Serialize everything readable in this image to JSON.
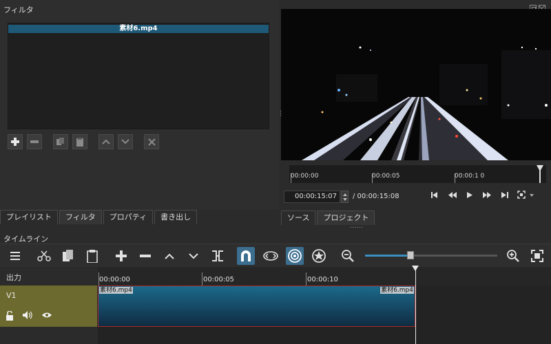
{
  "filter_panel": {
    "title": "フィルタ",
    "selected_clip": "素材6.mp4",
    "tools": [
      "plus-icon",
      "minus-icon",
      "copy-icon",
      "paste-icon",
      "up-icon",
      "down-icon",
      "deselect-icon"
    ]
  },
  "left_tabs": [
    "プレイリスト",
    "フィルタ",
    "プロパティ",
    "書き出し"
  ],
  "player": {
    "ruler_labels": [
      "00:00:00",
      "00:00:05",
      "00:00:1 0"
    ],
    "current_time": "00:00:15:07",
    "total_time": "/ 00:00:15:08",
    "controls": [
      "skip-start-icon",
      "rewind-icon",
      "play-icon",
      "fast-forward-icon",
      "skip-end-icon",
      "zoom-icon"
    ]
  },
  "right_tabs": [
    "ソース",
    "プロジェクト"
  ],
  "timeline": {
    "title": "タイムライン",
    "tools": [
      "menu-icon",
      "cut-icon",
      "copy-icon",
      "paste-icon",
      "append-icon",
      "remove-icon",
      "lift-icon",
      "overwrite-icon",
      "split-icon",
      "snap-icon",
      "scrub-icon",
      "ripple-icon",
      "ripple-all-icon",
      "zoom-out-icon",
      "zoom-in-icon",
      "zoom-fit-icon"
    ],
    "zoom_level": 0.33,
    "output_label": "出力",
    "track_label": "V1",
    "ruler_labels": [
      "00:00:00",
      "00:00:05",
      "00:00:10"
    ],
    "clip_name_start": "素材6.mp4",
    "clip_name_end": "素材6.mp4"
  },
  "colors": {
    "accent": "#1e5a78",
    "track_header": "#6c6a2e",
    "clip_border": "#a62b2b"
  }
}
